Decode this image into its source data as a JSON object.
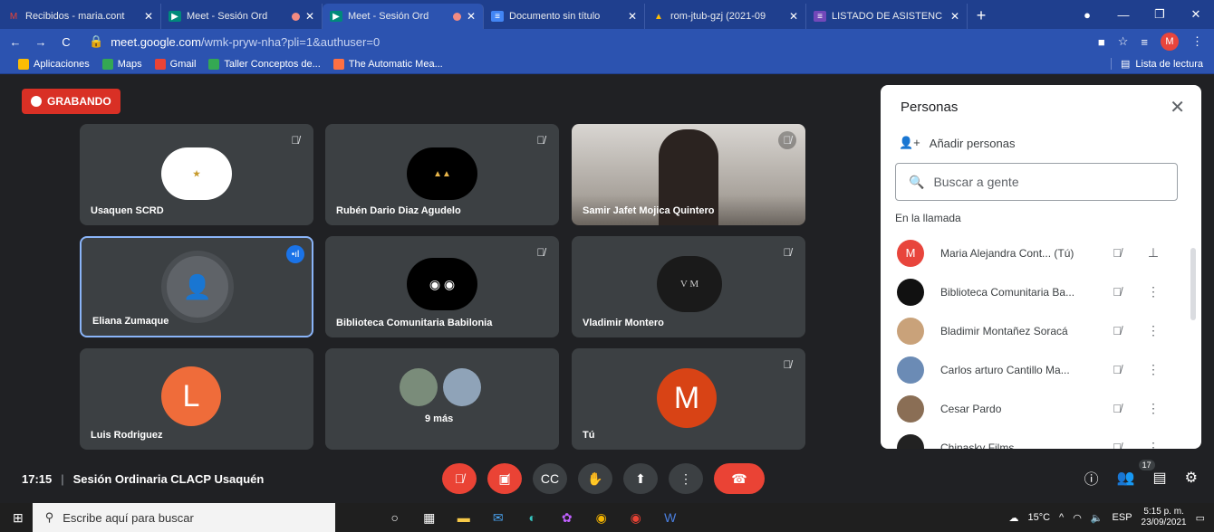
{
  "browser": {
    "tabs": [
      {
        "title": "Recibidos - maria.cont",
        "icon": "gmail-icon",
        "color": "#ea4335",
        "glyph": "M"
      },
      {
        "title": "Meet - Sesión Ord",
        "icon": "meet-icon",
        "color": "#00897b",
        "glyph": "▶"
      },
      {
        "title": "Meet - Sesión Ord",
        "icon": "meet-icon",
        "color": "#00897b",
        "glyph": "▶"
      },
      {
        "title": "Documento sin título",
        "icon": "docs-icon",
        "color": "#4285f4",
        "glyph": "≡"
      },
      {
        "title": "rom-jtub-gzj (2021-09",
        "icon": "drive-icon",
        "color": "#fbbc04",
        "glyph": "▲"
      },
      {
        "title": "LISTADO DE ASISTENC",
        "icon": "forms-icon",
        "color": "#7248b9",
        "glyph": "≡"
      }
    ],
    "url_domain": "meet.google.com",
    "url_path": "/wmk-pryw-nha?pli=1&authuser=0",
    "profile_initial": "M",
    "bookmarks": [
      "Aplicaciones",
      "Maps",
      "Gmail",
      "Taller Conceptos de...",
      "The Automatic Mea..."
    ],
    "reading_list": "Lista de lectura"
  },
  "meet": {
    "recording": "GRABANDO",
    "tiles": [
      {
        "name": "Usaquen SCRD"
      },
      {
        "name": "Rubén Dario Diaz Agudelo"
      },
      {
        "name": "Samir Jafet Mojica Quintero"
      },
      {
        "name": "Eliana Zumaque"
      },
      {
        "name": "Biblioteca Comunitaria Babilonia"
      },
      {
        "name": "Vladimir Montero"
      },
      {
        "name": "Luis Rodriguez",
        "letter": "L"
      },
      {
        "name": "9 más"
      },
      {
        "name": "Tú",
        "letter": "M"
      }
    ],
    "time": "17:15",
    "meeting_title": "Sesión Ordinaria CLACP Usaquén",
    "people_count": "17"
  },
  "panel": {
    "title": "Personas",
    "add_people": "Añadir personas",
    "search_placeholder": "Buscar a gente",
    "section": "En la llamada",
    "people": [
      {
        "name": "Maria Alejandra Cont... (Tú)",
        "initial": "M",
        "color": "#e8453c"
      },
      {
        "name": "Biblioteca Comunitaria Ba...",
        "initial": "",
        "color": "#111111"
      },
      {
        "name": "Bladimir Montañez Soracá",
        "initial": "",
        "color": "#c9a27a"
      },
      {
        "name": "Carlos arturo Cantillo Ma...",
        "initial": "",
        "color": "#6b8bb5"
      },
      {
        "name": "Cesar Pardo",
        "initial": "",
        "color": "#8a6e55"
      },
      {
        "name": "Chinasky Films",
        "initial": "",
        "color": "#222222"
      }
    ]
  },
  "taskbar": {
    "search_placeholder": "Escribe aquí para buscar",
    "weather": "15°C",
    "lang": "ESP",
    "time": "5:15 p. m.",
    "date": "23/09/2021"
  }
}
